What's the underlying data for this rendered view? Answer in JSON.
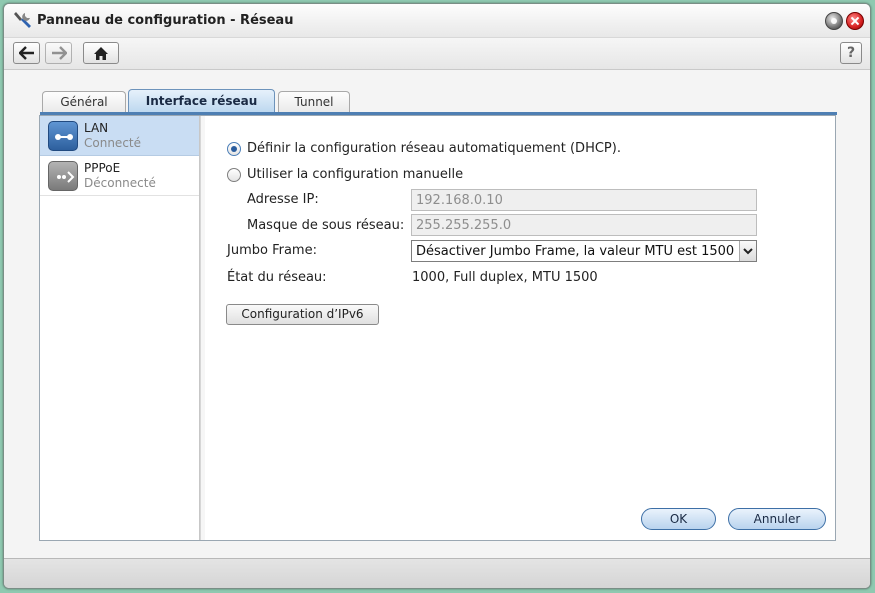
{
  "window": {
    "title": "Panneau de configuration - Réseau"
  },
  "tabs": [
    {
      "label": "Général"
    },
    {
      "label": "Interface réseau"
    },
    {
      "label": "Tunnel"
    }
  ],
  "sidebar": {
    "items": [
      {
        "name": "LAN",
        "status": "Connecté"
      },
      {
        "name": "PPPoE",
        "status": "Déconnecté"
      }
    ]
  },
  "form": {
    "radio_dhcp": "Définir la configuration réseau automatiquement (DHCP).",
    "radio_manual": "Utiliser la configuration manuelle",
    "ip_label": "Adresse IP:",
    "ip_value": "192.168.0.10",
    "mask_label": "Masque de sous réseau:",
    "mask_value": "255.255.255.0",
    "jumbo_label": "Jumbo Frame:",
    "jumbo_value": "Désactiver Jumbo Frame, la valeur MTU est 1500",
    "status_label": "État du réseau:",
    "status_value": "1000, Full duplex, MTU 1500",
    "ipv6_button": "Configuration d’IPv6"
  },
  "buttons": {
    "ok": "OK",
    "cancel": "Annuler"
  },
  "toolbar": {
    "help": "?"
  },
  "colors": {
    "accent": "#4e7fb3",
    "selected_bg": "#c9ddf3",
    "close": "#d62020"
  }
}
